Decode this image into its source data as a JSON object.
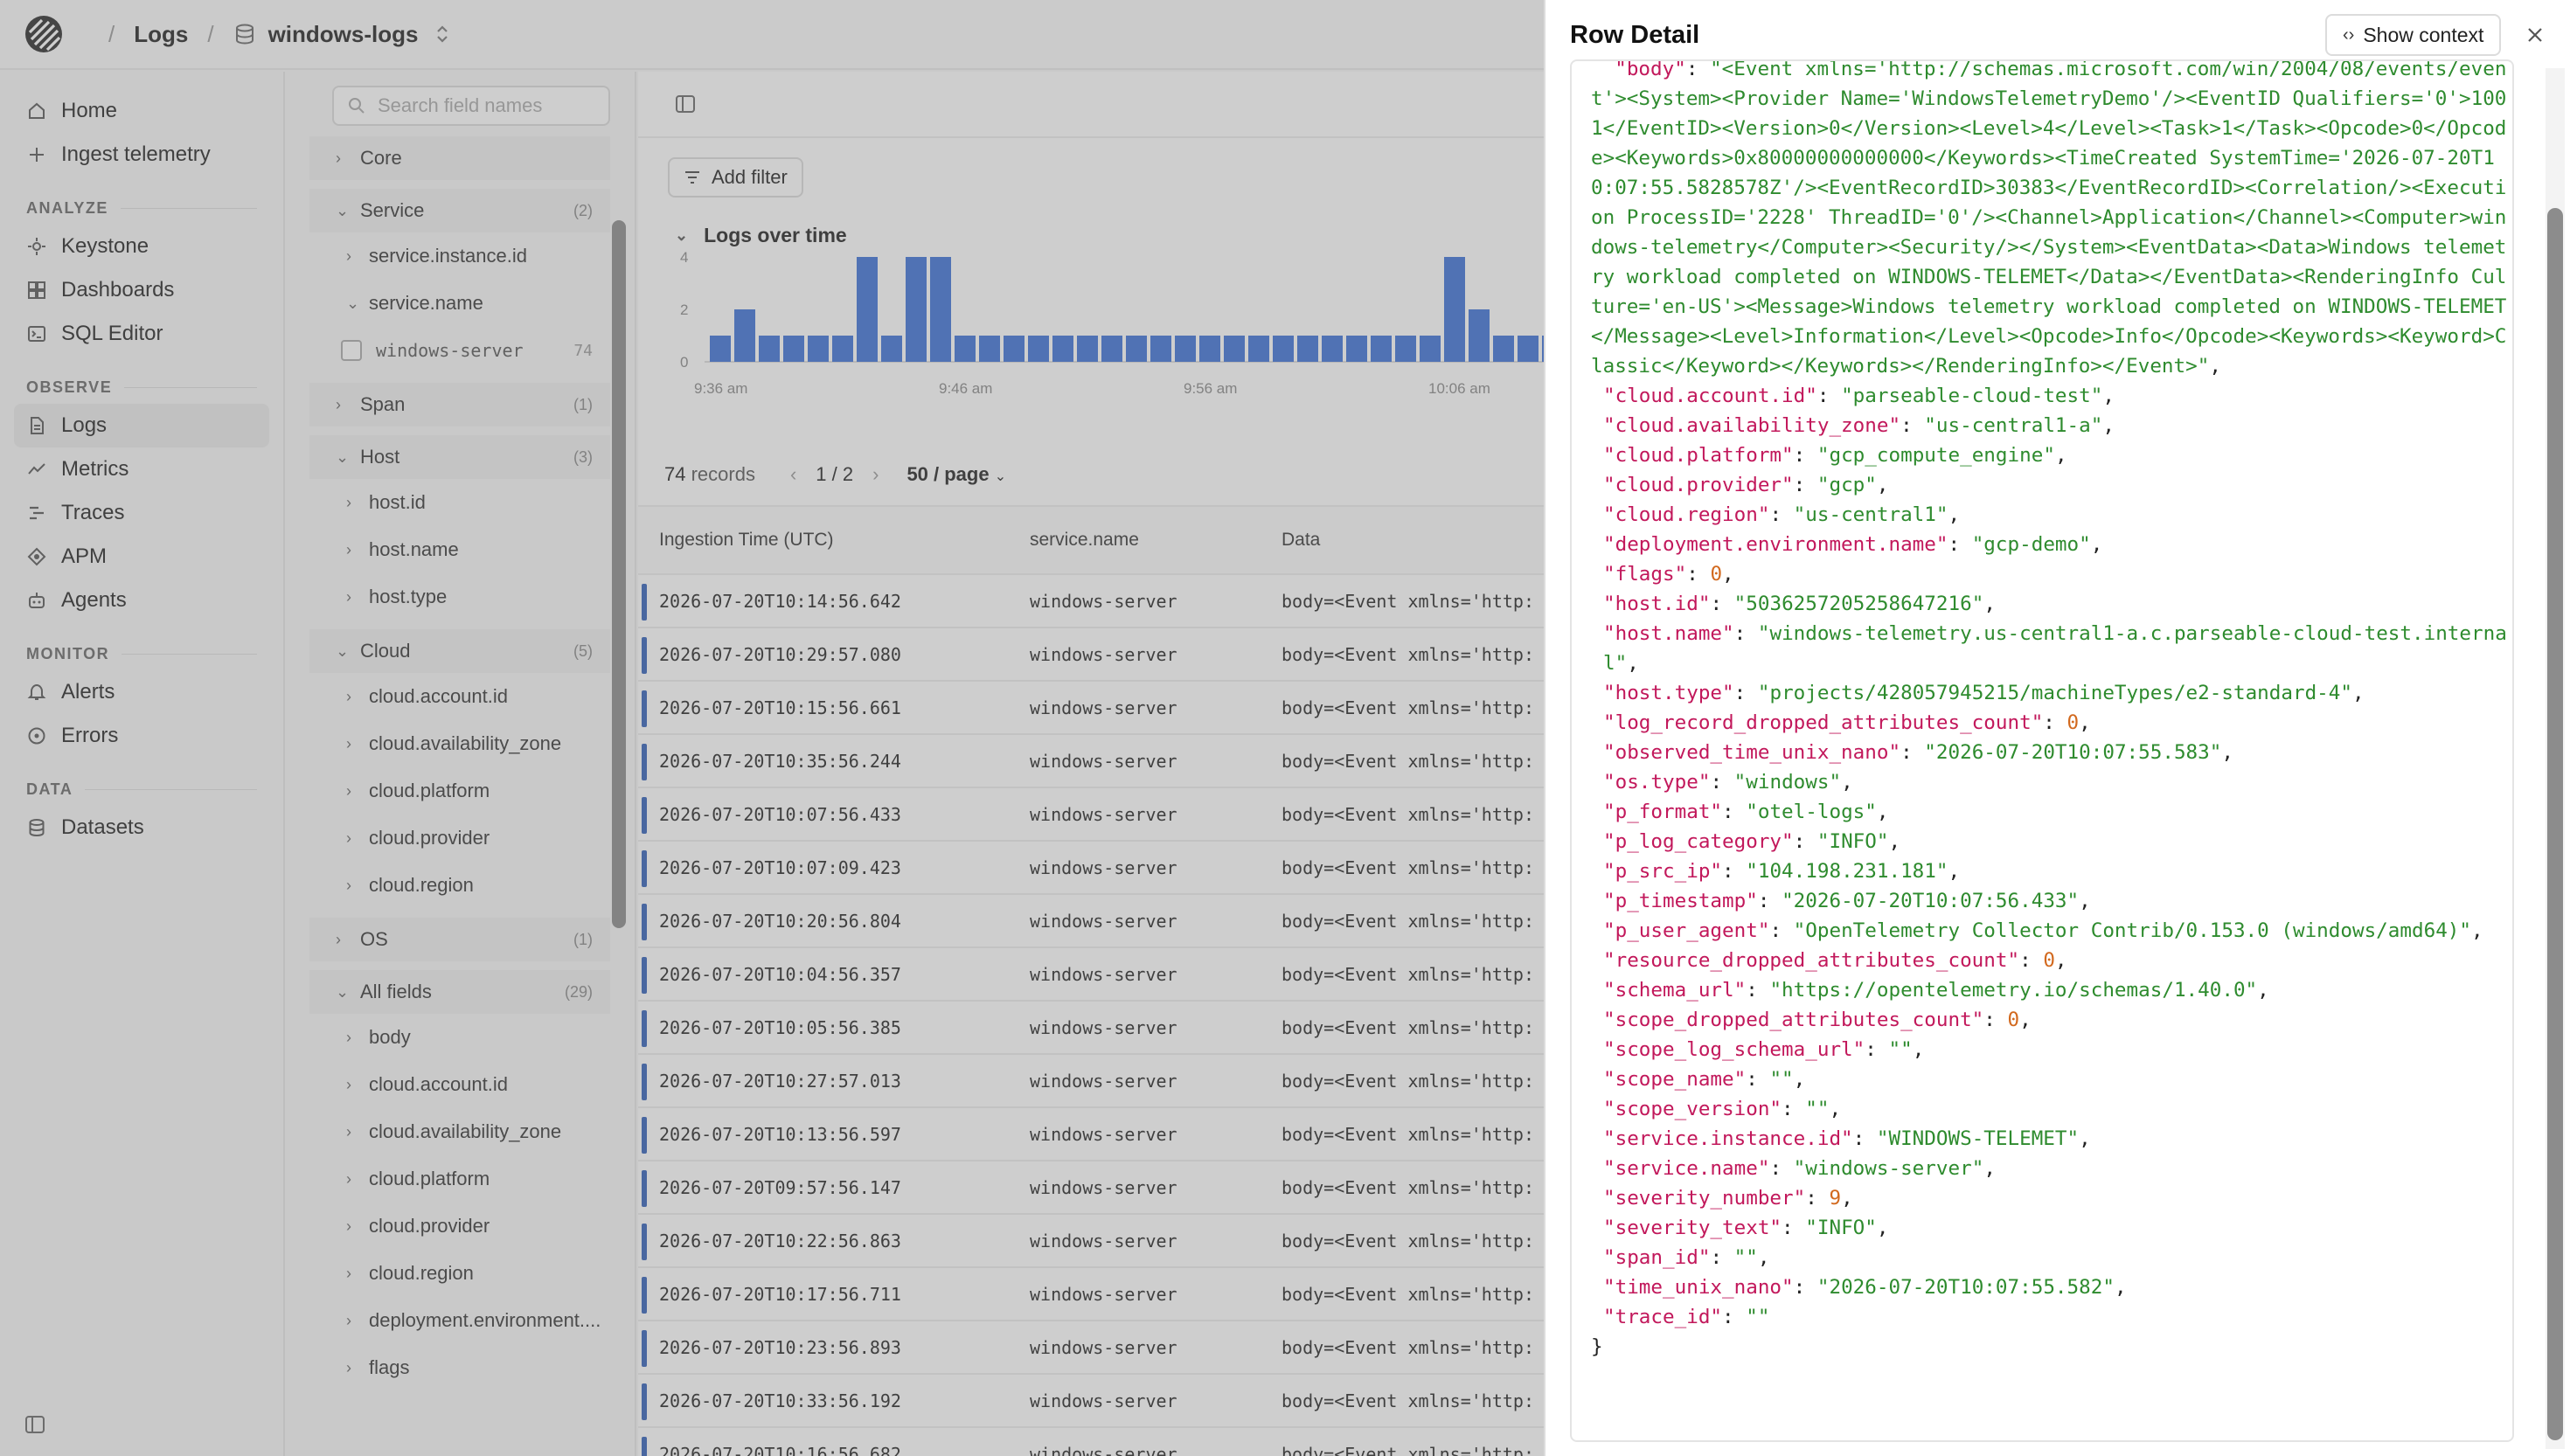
{
  "topbar": {
    "crumbs": [
      "Logs",
      "windows-logs"
    ]
  },
  "nav": {
    "top": [
      {
        "label": "Home",
        "icon": "home-icon"
      },
      {
        "label": "Ingest telemetry",
        "icon": "plus-icon"
      }
    ],
    "sections": [
      {
        "title": "ANALYZE",
        "items": [
          "Keystone",
          "Dashboards",
          "SQL Editor"
        ]
      },
      {
        "title": "OBSERVE",
        "items": [
          "Logs",
          "Metrics",
          "Traces",
          "APM",
          "Agents"
        ]
      },
      {
        "title": "MONITOR",
        "items": [
          "Alerts",
          "Errors"
        ]
      },
      {
        "title": "DATA",
        "items": [
          "Datasets"
        ]
      }
    ]
  },
  "fields": {
    "search_placeholder": "Search field names",
    "core": "Core",
    "service": {
      "label": "Service",
      "count": "(2)"
    },
    "service_instance_id": "service.instance.id",
    "service_name": "service.name",
    "service_value": {
      "label": "windows-server",
      "count": "74"
    },
    "span": {
      "label": "Span",
      "count": "(1)"
    },
    "host": {
      "label": "Host",
      "count": "(3)"
    },
    "host_items": [
      "host.id",
      "host.name",
      "host.type"
    ],
    "cloud": {
      "label": "Cloud",
      "count": "(5)"
    },
    "cloud_items": [
      "cloud.account.id",
      "cloud.availability_zone",
      "cloud.platform",
      "cloud.provider",
      "cloud.region"
    ],
    "os": {
      "label": "OS",
      "count": "(1)"
    },
    "all": {
      "label": "All fields",
      "count": "(29)"
    },
    "all_items": [
      "body",
      "cloud.account.id",
      "cloud.availability_zone",
      "cloud.platform",
      "cloud.provider",
      "cloud.region",
      "deployment.environment....",
      "flags"
    ]
  },
  "main": {
    "add_filter": "Add filter",
    "chart_title": "Logs over time",
    "chart_ticks_y": [
      "4",
      "2",
      "0"
    ],
    "chart_ticks_x": [
      "9:36 am",
      "9:46 am",
      "9:56 am",
      "10:06 am"
    ],
    "chart_bars": [
      1,
      2,
      1,
      1,
      1,
      1,
      4,
      1,
      4,
      4,
      1,
      1,
      1,
      1,
      1,
      1,
      1,
      1,
      1,
      1,
      1,
      1,
      1,
      1,
      1,
      1,
      1,
      1,
      1,
      1,
      4,
      2,
      1,
      1,
      1,
      1
    ],
    "records": "74",
    "records_label": "records",
    "page": "1 / 2",
    "per_page": "50 / page",
    "columns": [
      "Ingestion Time (UTC)",
      "service.name",
      "Data"
    ],
    "rows": [
      [
        "2026-07-20T10:14:56.642",
        "windows-server",
        "body=<Event xmlns='http:"
      ],
      [
        "2026-07-20T10:29:57.080",
        "windows-server",
        "body=<Event xmlns='http:"
      ],
      [
        "2026-07-20T10:15:56.661",
        "windows-server",
        "body=<Event xmlns='http:"
      ],
      [
        "2026-07-20T10:35:56.244",
        "windows-server",
        "body=<Event xmlns='http:"
      ],
      [
        "2026-07-20T10:07:56.433",
        "windows-server",
        "body=<Event xmlns='http:"
      ],
      [
        "2026-07-20T10:07:09.423",
        "windows-server",
        "body=<Event xmlns='http:"
      ],
      [
        "2026-07-20T10:20:56.804",
        "windows-server",
        "body=<Event xmlns='http:"
      ],
      [
        "2026-07-20T10:04:56.357",
        "windows-server",
        "body=<Event xmlns='http:"
      ],
      [
        "2026-07-20T10:05:56.385",
        "windows-server",
        "body=<Event xmlns='http:"
      ],
      [
        "2026-07-20T10:27:57.013",
        "windows-server",
        "body=<Event xmlns='http:"
      ],
      [
        "2026-07-20T10:13:56.597",
        "windows-server",
        "body=<Event xmlns='http:"
      ],
      [
        "2026-07-20T09:57:56.147",
        "windows-server",
        "body=<Event xmlns='http:"
      ],
      [
        "2026-07-20T10:22:56.863",
        "windows-server",
        "body=<Event xmlns='http:"
      ],
      [
        "2026-07-20T10:17:56.711",
        "windows-server",
        "body=<Event xmlns='http:"
      ],
      [
        "2026-07-20T10:23:56.893",
        "windows-server",
        "body=<Event xmlns='http:"
      ],
      [
        "2026-07-20T10:33:56.192",
        "windows-server",
        "body=<Event xmlns='http:"
      ],
      [
        "2026-07-20T10:16:56.682",
        "windows-server",
        "body=<Event xmlns='http:"
      ]
    ]
  },
  "detail": {
    "title": "Row Detail",
    "show_context": "Show context",
    "body_key": "\"body\"",
    "body_value": "\"<Event xmlns='http://schemas.microsoft.com/win/2004/08/events/event'><System><Provider Name='WindowsTelemetryDemo'/><EventID Qualifiers='0'>1001</EventID><Version>0</Version><Level>4</Level><Task>1</Task><Opcode>0</Opcode><Keywords>0x80000000000000</Keywords><TimeCreated SystemTime='2026-07-20T10:07:55.5828578Z'/><EventRecordID>30383</EventRecordID><Correlation/><Execution ProcessID='2228' ThreadID='0'/><Channel>Application</Channel><Computer>windows-telemetry</Computer><Security/></System><EventData><Data>Windows telemetry workload completed on WINDOWS-TELEMET</Data></EventData><RenderingInfo Culture='en-US'><Message>Windows telemetry workload completed on WINDOWS-TELEMET</Message><Level>Information</Level><Opcode>Info</Opcode><Keywords><Keyword>Classic</Keyword></Keywords></RenderingInfo></Event>\"",
    "fields": [
      {
        "key": "cloud.account.id",
        "value": "\"parseable-cloud-test\"",
        "type": "s"
      },
      {
        "key": "cloud.availability_zone",
        "value": "\"us-central1-a\"",
        "type": "s"
      },
      {
        "key": "cloud.platform",
        "value": "\"gcp_compute_engine\"",
        "type": "s"
      },
      {
        "key": "cloud.provider",
        "value": "\"gcp\"",
        "type": "s"
      },
      {
        "key": "cloud.region",
        "value": "\"us-central1\"",
        "type": "s"
      },
      {
        "key": "deployment.environment.name",
        "value": "\"gcp-demo\"",
        "type": "s"
      },
      {
        "key": "flags",
        "value": "0",
        "type": "n"
      },
      {
        "key": "host.id",
        "value": "\"5036257205258647216\"",
        "type": "s"
      },
      {
        "key": "host.name",
        "value": "\"windows-telemetry.us-central1-a.c.parseable-cloud-test.internal\"",
        "type": "s"
      },
      {
        "key": "host.type",
        "value": "\"projects/428057945215/machineTypes/e2-standard-4\"",
        "type": "s"
      },
      {
        "key": "log_record_dropped_attributes_count",
        "value": "0",
        "type": "n"
      },
      {
        "key": "observed_time_unix_nano",
        "value": "\"2026-07-20T10:07:55.583\"",
        "type": "s"
      },
      {
        "key": "os.type",
        "value": "\"windows\"",
        "type": "s"
      },
      {
        "key": "p_format",
        "value": "\"otel-logs\"",
        "type": "s"
      },
      {
        "key": "p_log_category",
        "value": "\"INFO\"",
        "type": "s"
      },
      {
        "key": "p_src_ip",
        "value": "\"104.198.231.181\"",
        "type": "s"
      },
      {
        "key": "p_timestamp",
        "value": "\"2026-07-20T10:07:56.433\"",
        "type": "s"
      },
      {
        "key": "p_user_agent",
        "value": "\"OpenTelemetry Collector Contrib/0.153.0 (windows/amd64)\"",
        "type": "s"
      },
      {
        "key": "resource_dropped_attributes_count",
        "value": "0",
        "type": "n"
      },
      {
        "key": "schema_url",
        "value": "\"https://opentelemetry.io/schemas/1.40.0\"",
        "type": "s"
      },
      {
        "key": "scope_dropped_attributes_count",
        "value": "0",
        "type": "n"
      },
      {
        "key": "scope_log_schema_url",
        "value": "\"\"",
        "type": "s"
      },
      {
        "key": "scope_name",
        "value": "\"\"",
        "type": "s"
      },
      {
        "key": "scope_version",
        "value": "\"\"",
        "type": "s"
      },
      {
        "key": "service.instance.id",
        "value": "\"WINDOWS-TELEMET\"",
        "type": "s"
      },
      {
        "key": "service.name",
        "value": "\"windows-server\"",
        "type": "s"
      },
      {
        "key": "severity_number",
        "value": "9",
        "type": "n"
      },
      {
        "key": "severity_text",
        "value": "\"INFO\"",
        "type": "s"
      },
      {
        "key": "span_id",
        "value": "\"\"",
        "type": "s"
      },
      {
        "key": "time_unix_nano",
        "value": "\"2026-07-20T10:07:55.582\"",
        "type": "s"
      },
      {
        "key": "trace_id",
        "value": "\"\"",
        "type": "s"
      }
    ],
    "closing_brace": "}"
  },
  "colors": {
    "accent": "#2f5fb8",
    "bar": "#3b6fd6",
    "json_key": "#c2185b",
    "json_string": "#2e8b2e",
    "json_number": "#d2691e"
  }
}
